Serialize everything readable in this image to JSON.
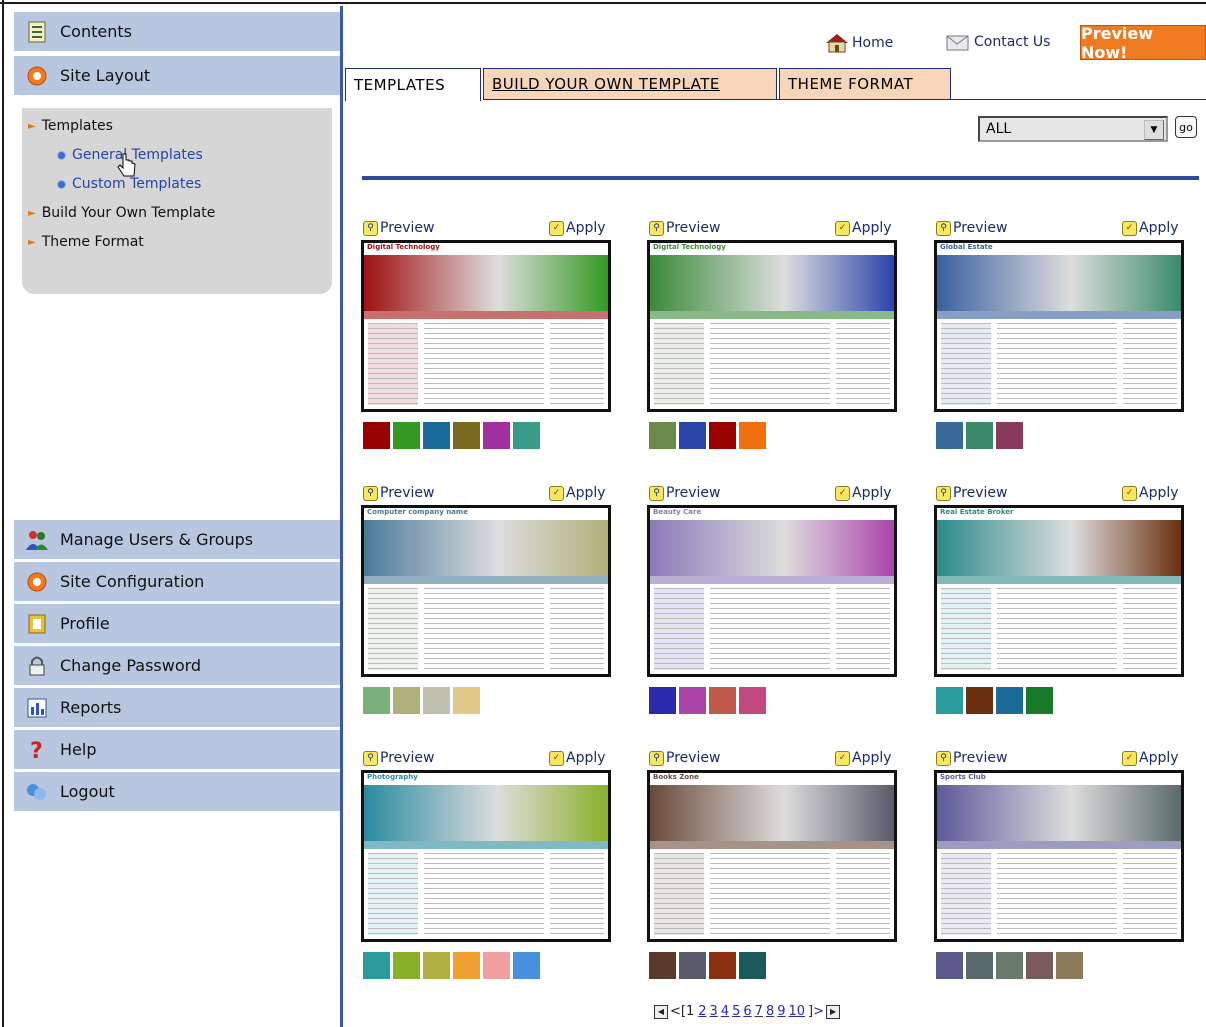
{
  "sidebar": {
    "contents": "Contents",
    "site_layout": "Site Layout",
    "templates": "Templates",
    "general_templates": "General Templates",
    "custom_templates": "Custom Templates",
    "build_own": "Build Your Own Template",
    "theme_format": "Theme Format",
    "manage_users": "Manage Users & Groups",
    "site_configuration": "Site Configuration",
    "profile": "Profile",
    "change_password": "Change Password",
    "reports": "Reports",
    "help": "Help",
    "logout": "Logout"
  },
  "header": {
    "home": "Home",
    "contact": "Contact Us",
    "preview_now": "Preview Now!"
  },
  "tabs": {
    "templates": "TEMPLATES",
    "build": "BUILD YOUR OWN TEMPLATE",
    "theme": "THEME FORMAT"
  },
  "filter": {
    "selected": "ALL",
    "go": "go"
  },
  "actions": {
    "preview": "Preview",
    "apply": "Apply"
  },
  "templates": [
    {
      "title": "Digital Technology",
      "swatches": [
        "#990000",
        "#339922",
        "#1a6a9a",
        "#7a6a20",
        "#a030a0",
        "#3a9a8a"
      ],
      "accent": "#a01010"
    },
    {
      "title": "Digital Technology",
      "swatches": [
        "#6a8a4a",
        "#2a44aa",
        "#990000",
        "#f07010"
      ],
      "accent": "#3a8a3a"
    },
    {
      "title": "Global Estate",
      "swatches": [
        "#3a6a9a",
        "#3a8a6a",
        "#8a3a5a"
      ],
      "accent": "#3a60a0"
    },
    {
      "title": "Computer company name",
      "swatches": [
        "#7ab07a",
        "#b0b07a",
        "#c0c0b0",
        "#e0c888"
      ],
      "accent": "#4a7a9a"
    },
    {
      "title": "Beauty Care",
      "swatches": [
        "#2a2aaa",
        "#aa44aa",
        "#c05a4a",
        "#c04a80"
      ],
      "accent": "#8a7ab8"
    },
    {
      "title": "Real Estate Broker",
      "swatches": [
        "#2a9a9a",
        "#6a3010",
        "#1a6a9a",
        "#1a7a2a"
      ],
      "accent": "#2a8a8a"
    },
    {
      "title": "Photography",
      "swatches": [
        "#2a9a9a",
        "#8ab02a",
        "#b0b040",
        "#f0a030",
        "#f0a0a0",
        "#4a90e0"
      ],
      "accent": "#2a8aa0"
    },
    {
      "title": "Books Zone",
      "swatches": [
        "#5a3a2a",
        "#5a5a6a",
        "#8a3010",
        "#1a5a5a"
      ],
      "accent": "#6a4a3a"
    },
    {
      "title": "Sports Club",
      "swatches": [
        "#5a5a8a",
        "#5a6a6a",
        "#6a7a6a",
        "#7a5a5a",
        "#8a7a5a"
      ],
      "accent": "#5a5a9a"
    }
  ],
  "pager": {
    "open": "[1",
    "pages": [
      "2",
      "3",
      "4",
      "5",
      "6",
      "7",
      "8",
      "9",
      "10"
    ],
    "close": "]"
  }
}
